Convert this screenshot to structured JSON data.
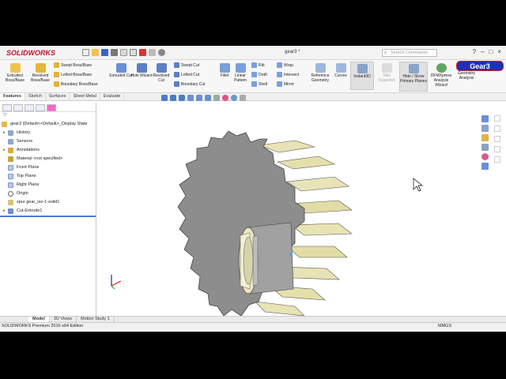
{
  "app": {
    "brand": "SOLIDWORKS",
    "doc_title": "gear3 *"
  },
  "search": {
    "placeholder": "Search Commands"
  },
  "badge": {
    "text": "Gear3"
  },
  "ribbon": {
    "extruded_boss": "Extruded Boss/Base",
    "revolved_boss": "Revolved Boss/Base",
    "swept_boss": "Swept Boss/Base",
    "lofted_boss": "Lofted Boss/Base",
    "boundary_boss": "Boundary Boss/Base",
    "extruded_cut": "Extruded Cut",
    "hole_wizard": "Hole Wizard",
    "revolved_cut": "Revolved Cut",
    "swept_cut": "Swept Cut",
    "lofted_cut": "Lofted Cut",
    "boundary_cut": "Boundary Cut",
    "fillet": "Fillet",
    "linear_pattern": "Linear Pattern",
    "rib": "Rib",
    "draft": "Draft",
    "shell": "Shell",
    "wrap": "Wrap",
    "intersect": "Intersect",
    "mirror": "Mirror",
    "reference_geometry": "Reference Geometry",
    "curves": "Curves",
    "instant3d": "Instant3D",
    "take_snapshot": "Take Snapshot",
    "hide_show": "Hide / Show Primary Planes",
    "dfm": "DFMXpress Analysis Wizard",
    "geometry_analysis": "Geometry Analysis"
  },
  "command_tabs": [
    "Features",
    "Sketch",
    "Surfaces",
    "Sheet Metal",
    "Evaluate"
  ],
  "tree": {
    "root": "gear3 (Default<<Default>_Display State",
    "items": [
      "History",
      "Sensors",
      "Annotations",
      "Material <not specified>",
      "Front Plane",
      "Top Plane",
      "Right Plane",
      "Origin",
      "spur gear_iso-1-solid1",
      "Cut-Extrude1"
    ]
  },
  "bottom_tabs": [
    "Model",
    "3D Views",
    "Motion Study 1"
  ],
  "status": {
    "text": "SOLIDWORKS Premium 2016 x64 Edition",
    "units": "MMGS"
  },
  "colors": {
    "brand": "#c8102e",
    "badge": "#1f2fb8",
    "tooth_face": "#e7e3b4",
    "body": "#8a8a8a"
  }
}
